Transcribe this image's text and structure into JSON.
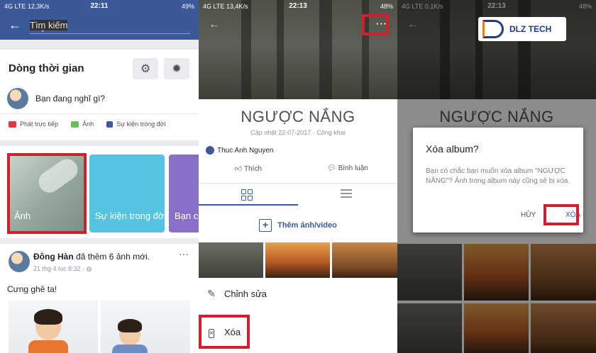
{
  "panel1": {
    "status": {
      "left": "4G LTE 12,3K/s",
      "time": "22:11",
      "battery": "49%"
    },
    "search": {
      "placeholder": "Tìm kiếm"
    },
    "timeline": {
      "title": "Dòng thời gian",
      "prompt": "Bạn đang nghĩ gì?",
      "actions": [
        "Phát trực tiếp",
        "Ảnh",
        "Sự kiện trong đời"
      ]
    },
    "tiles": [
      "Ảnh",
      "Sự kiện trong đời",
      "Bạn c"
    ],
    "post": {
      "name": "Đông Hàn",
      "action": "đã thêm 6 ảnh mới.",
      "meta": "21 thg 4 lúc 8:32 · ",
      "text": "Cưng ghê ta!",
      "more": "···"
    }
  },
  "panel2": {
    "status": {
      "left": "4G LTE 13,4K/s",
      "time": "22:13",
      "battery": "48%"
    },
    "album": {
      "title": "NGƯỢC NẮNG",
      "meta": "Cập nhật 22-07-2017 · Công khai",
      "owner": "Thuc Anh Nguyen",
      "like": "Thích",
      "comment": "Bình luận",
      "add_label": "Thêm ảnh/video"
    },
    "menu_dots": "···",
    "sheet": {
      "edit": "Chỉnh sửa",
      "delete": "Xóa"
    }
  },
  "panel3": {
    "status": {
      "left": "4G LTE 0,1K/s",
      "time": "22:13",
      "battery": "48%"
    },
    "album_title": "NGƯỢC NẮNG",
    "dialog": {
      "title": "Xóa album?",
      "body": "Bạn có chắc bạn muốn xóa album \"NGƯỢC NẮNG\"? Ảnh trong album này cũng sẽ bị xóa.",
      "cancel": "HỦY",
      "confirm": "XÓA"
    }
  },
  "watermark": {
    "text": "DLZ TECH"
  },
  "colors": {
    "facebook_blue": "#3b5998",
    "highlight_red": "#d0202f"
  }
}
